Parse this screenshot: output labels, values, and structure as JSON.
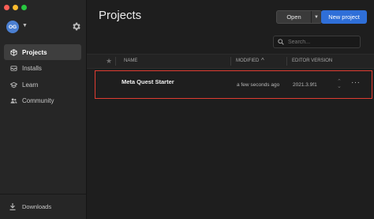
{
  "window": {
    "traffic_lights": {
      "close": "#fe5f57",
      "minimize": "#febc2e",
      "zoom": "#28c840"
    }
  },
  "sidebar": {
    "avatar_initials": "OG",
    "avatar_color": "#4a7fd1",
    "items": [
      {
        "label": "Projects",
        "icon": "cube-icon",
        "active": true
      },
      {
        "label": "Installs",
        "icon": "installs-icon",
        "active": false
      },
      {
        "label": "Learn",
        "icon": "learn-icon",
        "active": false
      },
      {
        "label": "Community",
        "icon": "community-icon",
        "active": false
      }
    ],
    "downloads_label": "Downloads"
  },
  "main": {
    "title": "Projects",
    "open_label": "Open",
    "new_project_label": "New project",
    "accent_color": "#2f6fd8",
    "search_placeholder": "Search..."
  },
  "table": {
    "columns": {
      "name": "NAME",
      "modified": "MODIFIED",
      "editor_version": "EDITOR VERSION"
    },
    "sort_indicator": "^",
    "rows": [
      {
        "name": "Meta Quest Starter",
        "modified": "a few seconds ago",
        "editor_version": "2021.3.9f1",
        "highlighted": true,
        "highlight_color": "#e03c31"
      }
    ]
  }
}
